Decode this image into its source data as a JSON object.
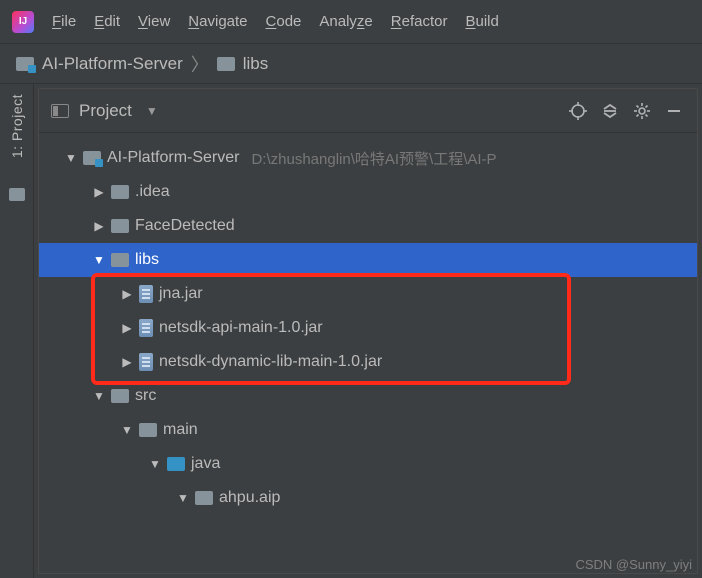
{
  "menu": {
    "items": [
      "File",
      "Edit",
      "View",
      "Navigate",
      "Code",
      "Analyze",
      "Refactor",
      "Build"
    ]
  },
  "breadcrumb": {
    "root": "AI-Platform-Server",
    "child": "libs"
  },
  "sidebar": {
    "tab_label": "1: Project"
  },
  "panel": {
    "title": "Project"
  },
  "tree": {
    "root": {
      "name": "AI-Platform-Server",
      "path": "D:\\zhushanglin\\哈特AI预警\\工程\\AI-P"
    },
    "idea": ".idea",
    "face": "FaceDetected",
    "libs": "libs",
    "jar1": "jna.jar",
    "jar2": "netsdk-api-main-1.0.jar",
    "jar3": "netsdk-dynamic-lib-main-1.0.jar",
    "src": "src",
    "main": "main",
    "java": "java",
    "pkg": "ahpu.aip"
  },
  "watermark": "CSDN @Sunny_yiyi"
}
